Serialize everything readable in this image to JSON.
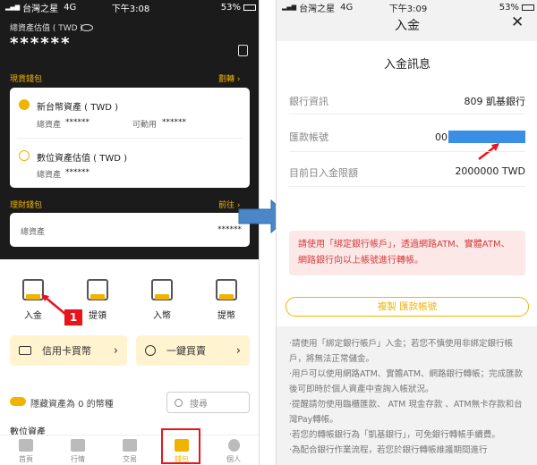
{
  "left": {
    "status": {
      "carrier": "台灣之星",
      "network": "4G",
      "time": "下午3:08",
      "battery": "53%"
    },
    "assets": {
      "label": "總資產估值 ( TWD )",
      "value": "******"
    },
    "spot": {
      "section_label": "現貨錢包",
      "action": "劃轉",
      "twd": {
        "title": "新台幣資產 ( TWD )",
        "total_label": "總資產",
        "total_value": "******",
        "avail_label": "可動用",
        "avail_value": "******"
      },
      "digital": {
        "title": "數位資產估值 ( TWD )",
        "total_label": "總資產",
        "total_value": "******"
      }
    },
    "finance": {
      "section_label": "理財錢包",
      "action": "前往",
      "total_label": "總資產",
      "total_value": "******"
    },
    "actions": [
      "入金",
      "提領",
      "入幣",
      "提幣"
    ],
    "badge": "1",
    "buttons": {
      "credit": "信用卡買幣",
      "oneclick": "一鍵買賣"
    },
    "hide_label": "隱藏資產為 0 的幣種",
    "search_placeholder": "搜尋",
    "digital_section": "數位資產",
    "tabs": [
      "首頁",
      "行情",
      "交易",
      "錢包",
      "個人"
    ]
  },
  "right": {
    "status": {
      "carrier": "台灣之星",
      "network": "4G",
      "time": "下午3:09",
      "battery": "53%"
    },
    "title": "入金",
    "section_title": "入金訊息",
    "rows": [
      {
        "label": "銀行資訊",
        "value": "809 凱基銀行"
      },
      {
        "label": "匯款帳號",
        "value": "00"
      },
      {
        "label": "目前日入金限額",
        "value": "2000000 TWD"
      }
    ],
    "warning": "請使用「綁定銀行帳戶」，透過網路ATM、實體ATM、網路銀行向以上帳號進行轉帳。",
    "copy_button": "複製 匯款帳號",
    "notes": [
      "·請使用「綁定銀行帳戶」入金；若您不慎使用非綁定銀行帳戶，將無法正常儲金。",
      "·用戶可以使用網路ATM、實體ATM、網路銀行轉帳；完成匯款後可即時於個人資產中查詢入帳狀況。",
      "·提醒請勿使用臨櫃匯款、 ATM 現金存款 、ATM無卡存款和台灣Pay轉帳。",
      "·若您的轉帳銀行為「凱基銀行」，可免銀行轉帳手續費。",
      "·為配合銀行作業流程，若您於銀行轉帳維護期間進行"
    ]
  },
  "colors": {
    "accent": "#f0b400",
    "dark_bg": "#1b1b1b",
    "warning_bg": "#fde8e8",
    "warning_text": "#d23c3c",
    "redact": "#3a8ee6",
    "annotation": "#e8141c",
    "arrow": "#4a86c8"
  }
}
